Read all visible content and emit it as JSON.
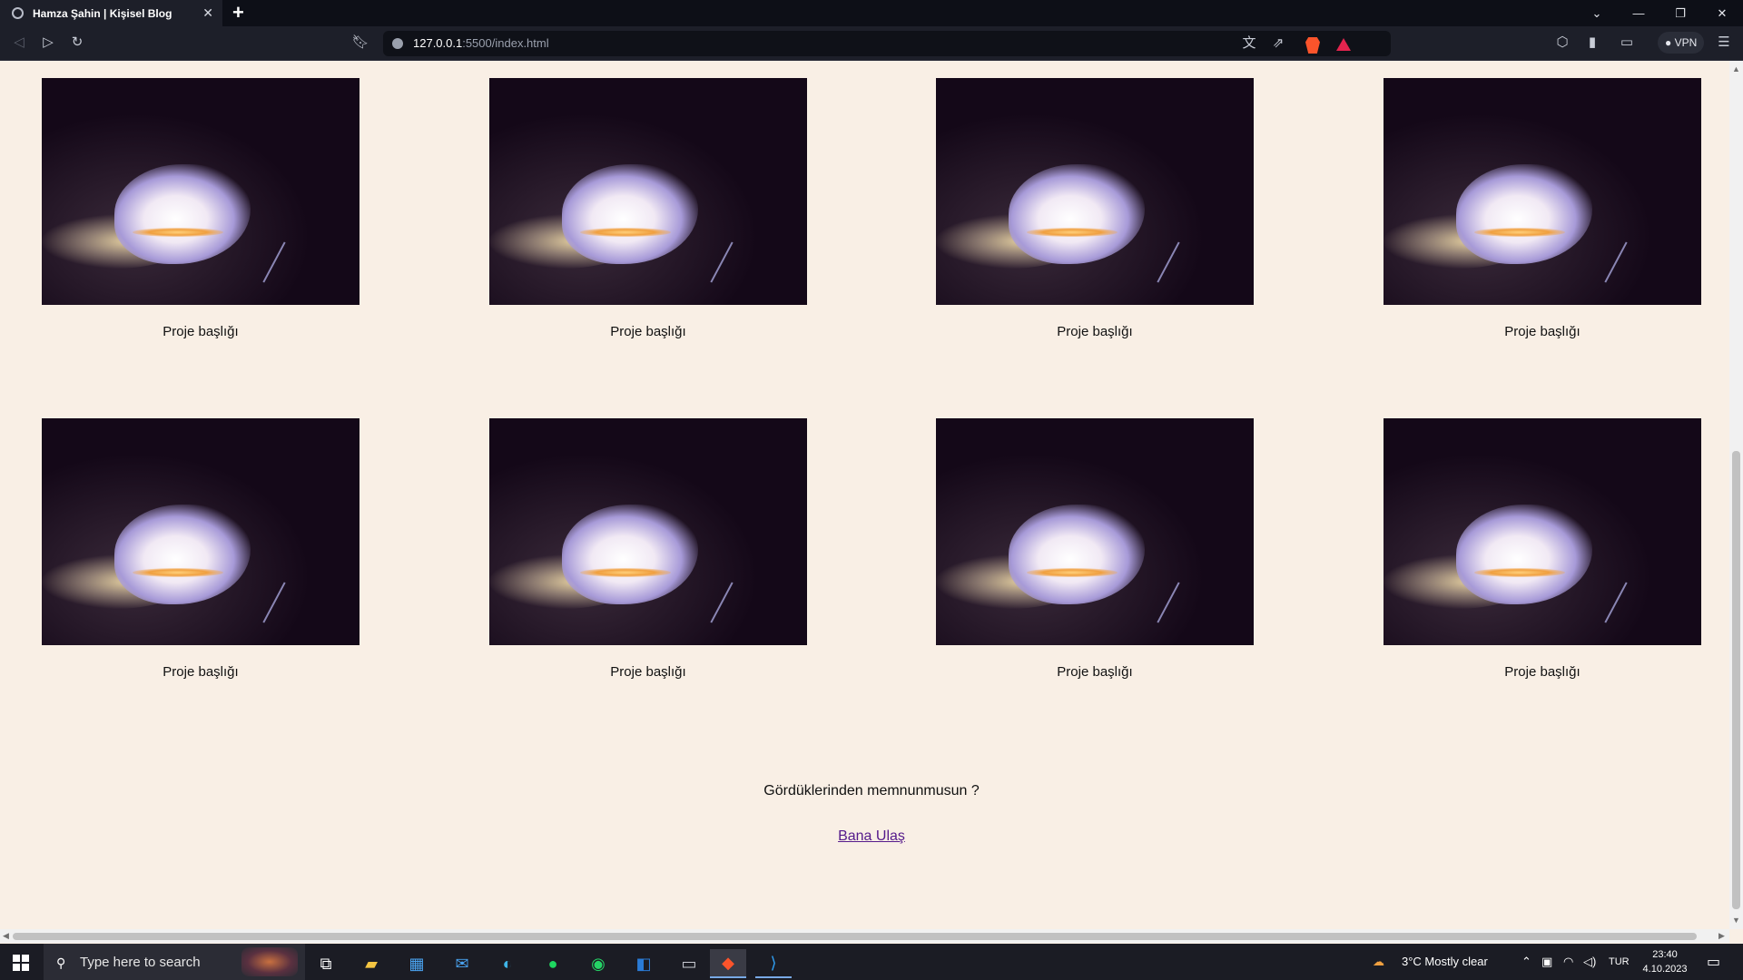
{
  "browser": {
    "tab_title": "Hamza Şahin | Kişisel Blog",
    "tab_close": "✕",
    "new_tab": "+",
    "url_host": "127.0.0.1",
    "url_path": ":5500/index.html",
    "vpn_label": "VPN",
    "window_controls": [
      "⌄",
      "—",
      "❐",
      "✕"
    ]
  },
  "projects": [
    {
      "caption": "Proje başlığı"
    },
    {
      "caption": "Proje başlığı"
    },
    {
      "caption": "Proje başlığı"
    },
    {
      "caption": "Proje başlığı"
    },
    {
      "caption": "Proje başlığı"
    },
    {
      "caption": "Proje başlığı"
    },
    {
      "caption": "Proje başlığı"
    },
    {
      "caption": "Proje başlığı"
    }
  ],
  "footer": {
    "question": "Gördüklerinden memnunmusun ?",
    "contact_link": "Bana Ulaş"
  },
  "taskbar": {
    "search_placeholder": "Type here to search",
    "weather": "3°C  Mostly clear",
    "language": "TUR",
    "time": "23:40",
    "date": "4.10.2023"
  },
  "colors": {
    "page_bg": "#f9efe5",
    "link": "#551a8b",
    "browser_bg": "#1d1f29",
    "taskbar_bg": "#1b1c24"
  }
}
